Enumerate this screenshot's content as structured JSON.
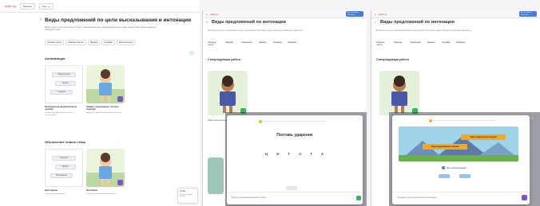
{
  "panel1": {
    "logo": "uchi.ru",
    "topbar_tabs": [
      "Музыка",
      "Учит"
    ],
    "title": "Виды предложений по цели высказывания и интонации",
    "description": "Видео-урок по русскому языку 3 класс: восклицательные и невосклицательные предложения. Выполните задания и проверьте себя.",
    "chips": [
      "Опорные тексты",
      "Образцы ответов",
      "Задания",
      "Тренажёр",
      "Дополнительно"
    ],
    "section1": {
      "heading": "Активизация",
      "pills": [
        "Побудительное",
        "Вопрос",
        "Утвердить"
      ],
      "card1_title": "Распределите предложения по группам",
      "card1_sub": "Укажите вид предложения по цели высказывания",
      "card2_title": "Найдите предложение, которое подходит",
      "card2_sub": "Выберите вариант ответа из предложенных"
    },
    "section2": {
      "heading": "Объяснение нового темы",
      "pills": [
        "Утвердить",
        "Вопрос",
        "Восклицание"
      ],
      "card1_title": "Цель фразы",
      "card1_sub": "Учим виды предложений",
      "card2_title": "Интонация",
      "card2_sub": "Слушаем и повторяем предложения"
    },
    "side_popup": {
      "title": "Cookie",
      "text": "Мы используем файлы"
    }
  },
  "panel2": {
    "logo": "uchi.ru",
    "blue_button": "Все задания / Шаблоны",
    "title": "Виды предложений по интонации",
    "description": "Восклицательные и невосклицательные предложения. Расставьте знаки, выберите правильные варианты.",
    "tabs": [
      "Опорные тексты",
      "Образцы",
      "Упражнения",
      "Задания",
      "Тренажер",
      "Проверка"
    ],
    "section_heading": "Стимулирующая работа",
    "card_caption": "Найди восклицательные предложения",
    "modal": {
      "title": "Поставь ударение",
      "letters": [
        "Ц",
        "И",
        "Т",
        "А",
        "Т",
        "А"
      ],
      "footer": "Выберите правильный вариант ответа"
    }
  },
  "panel3": {
    "logo": "uchi.ru",
    "blue_button": "Все задания / Шаблоны",
    "title": "Виды предложений по интонации",
    "description": "Восклицательные и невосклицательные предложения. Расставьте знаки, выберите правильные варианты.",
    "tabs": [
      "Опорные тексты",
      "Образцы",
      "Упражнения",
      "Задания",
      "Тренажер",
      "Проверка"
    ],
    "section_heading": "Стимулирующая работа",
    "modal": {
      "sign1": "Тема предложения верна!",
      "sign2": "Тема предложения ошибка",
      "question": "Это предложение?",
      "footer": "Определите вид предложения по интонации"
    }
  }
}
